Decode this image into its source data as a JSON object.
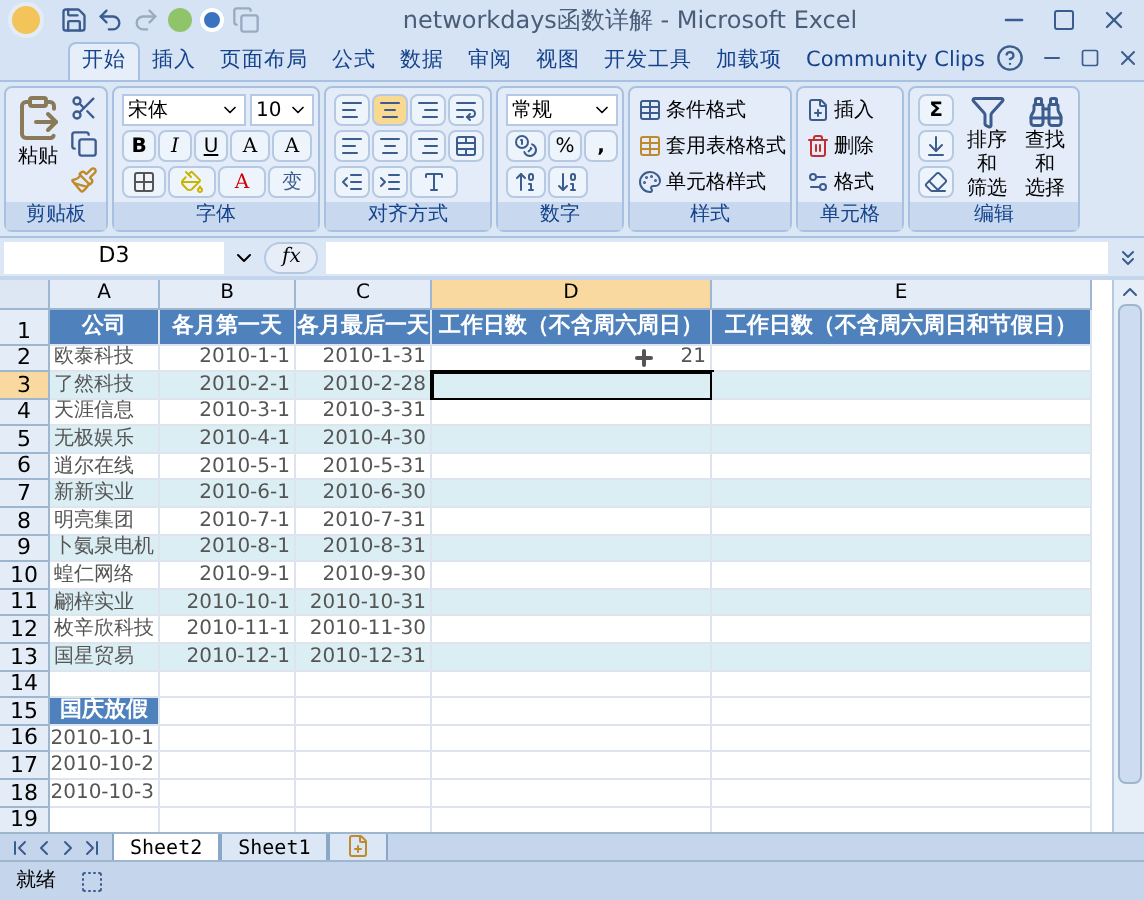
{
  "window": {
    "title": "networkdays函数详解 - Microsoft Excel"
  },
  "tabs": [
    {
      "label": "开始",
      "selected": true
    },
    {
      "label": "插入",
      "selected": false
    },
    {
      "label": "页面布局",
      "selected": false
    },
    {
      "label": "公式",
      "selected": false
    },
    {
      "label": "数据",
      "selected": false
    },
    {
      "label": "审阅",
      "selected": false
    },
    {
      "label": "视图",
      "selected": false
    },
    {
      "label": "开发工具",
      "selected": false
    },
    {
      "label": "加载项",
      "selected": false
    },
    {
      "label": "Community Clips",
      "selected": false
    }
  ],
  "ribbon": {
    "clipboard": {
      "label": "剪贴板",
      "paste": "粘贴"
    },
    "font": {
      "label": "字体",
      "font_name": "宋体",
      "font_size": "10",
      "bold": "B",
      "italic": "I",
      "underline": "U",
      "grow": "A",
      "shrink": "A",
      "font_color": "A",
      "phonetic": "变"
    },
    "alignment": {
      "label": "对齐方式"
    },
    "number": {
      "label": "数字",
      "format": "常规",
      "percent": "%",
      "comma": ","
    },
    "styles": {
      "label": "样式",
      "items": [
        "条件格式",
        "套用表格格式",
        "单元格样式"
      ]
    },
    "cells": {
      "label": "单元格",
      "items": [
        "插入",
        "删除",
        "格式"
      ]
    },
    "editing": {
      "label": "编辑",
      "sigma": "Σ",
      "commands": [
        {
          "lines": [
            "排序和",
            "筛选"
          ]
        },
        {
          "lines": [
            "查找和",
            "选择"
          ]
        }
      ]
    }
  },
  "formula_bar": {
    "name_box": "D3",
    "fx": "fx"
  },
  "sheet": {
    "columns": [
      {
        "label": "A",
        "selected": false
      },
      {
        "label": "B",
        "selected": false
      },
      {
        "label": "C",
        "selected": false
      },
      {
        "label": "D",
        "selected": true
      },
      {
        "label": "E",
        "selected": false
      }
    ],
    "rows": [
      {
        "number": "1",
        "selected": false,
        "kind": "header",
        "cells": [
          "公司",
          "各月第一天",
          "各月最后一天",
          "工作日数（不含周六周日）",
          "工作日数（不含周六周日和节假日）"
        ]
      },
      {
        "number": "2",
        "selected": false,
        "kind": "table",
        "cells": [
          "欧泰科技",
          "2010-1-1",
          "2010-1-31",
          "21",
          null
        ]
      },
      {
        "number": "3",
        "selected": true,
        "kind": "table",
        "cells": [
          "了然科技",
          "2010-2-1",
          "2010-2-28",
          null,
          null
        ]
      },
      {
        "number": "4",
        "selected": false,
        "kind": "table",
        "cells": [
          "天涯信息",
          "2010-3-1",
          "2010-3-31",
          null,
          null
        ]
      },
      {
        "number": "5",
        "selected": false,
        "kind": "table",
        "cells": [
          "无极娱乐",
          "2010-4-1",
          "2010-4-30",
          null,
          null
        ]
      },
      {
        "number": "6",
        "selected": false,
        "kind": "table",
        "cells": [
          "逍尔在线",
          "2010-5-1",
          "2010-5-31",
          null,
          null
        ]
      },
      {
        "number": "7",
        "selected": false,
        "kind": "table",
        "cells": [
          "新新实业",
          "2010-6-1",
          "2010-6-30",
          null,
          null
        ]
      },
      {
        "number": "8",
        "selected": false,
        "kind": "table",
        "cells": [
          "明亮集团",
          "2010-7-1",
          "2010-7-31",
          null,
          null
        ]
      },
      {
        "number": "9",
        "selected": false,
        "kind": "table",
        "cells": [
          "卜氨泉电机",
          "2010-8-1",
          "2010-8-31",
          null,
          null
        ]
      },
      {
        "number": "10",
        "selected": false,
        "kind": "table",
        "cells": [
          "蝗仁网络",
          "2010-9-1",
          "2010-9-30",
          null,
          null
        ]
      },
      {
        "number": "11",
        "selected": false,
        "kind": "table",
        "cells": [
          "翩梓实业",
          "2010-10-1",
          "2010-10-31",
          null,
          null
        ]
      },
      {
        "number": "12",
        "selected": false,
        "kind": "table",
        "cells": [
          "枚辛欣科技",
          "2010-11-1",
          "2010-11-30",
          null,
          null
        ]
      },
      {
        "number": "13",
        "selected": false,
        "kind": "table",
        "cells": [
          "国星贸易",
          "2010-12-1",
          "2010-12-31",
          null,
          null
        ]
      },
      {
        "number": "14",
        "selected": false,
        "kind": "empty",
        "cells": []
      },
      {
        "number": "15",
        "selected": false,
        "kind": "header",
        "cells": [
          "国庆放假"
        ]
      },
      {
        "number": "16",
        "selected": false,
        "kind": "list",
        "cells": [
          "2010-10-1"
        ]
      },
      {
        "number": "17",
        "selected": false,
        "kind": "list",
        "cells": [
          "2010-10-2"
        ]
      },
      {
        "number": "18",
        "selected": false,
        "kind": "list",
        "cells": [
          "2010-10-3"
        ]
      },
      {
        "number": "19",
        "selected": false,
        "kind": "empty",
        "cells": []
      }
    ]
  },
  "sheet_tabs": [
    {
      "label": "Sheet2",
      "selected": true
    },
    {
      "label": "Sheet1",
      "selected": false
    }
  ],
  "status_bar": {
    "status": "就绪"
  }
}
